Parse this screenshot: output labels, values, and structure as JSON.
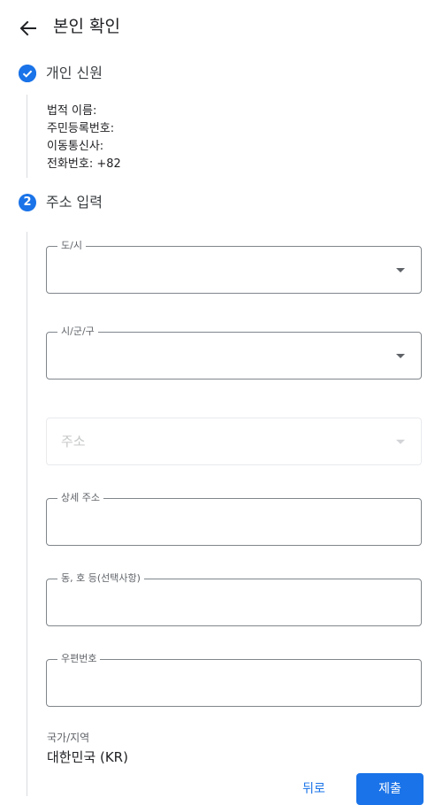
{
  "header": {
    "title": "본인 확인",
    "back_icon": "arrow-left-icon"
  },
  "steps": [
    {
      "number": "",
      "status": "completed",
      "icon": "check-circle-icon",
      "title": "개인 신원",
      "info": [
        "법적 이름:",
        "주민등록번호:",
        "이동통신사:",
        "전화번호: +82"
      ]
    },
    {
      "number": "2",
      "status": "active",
      "title": "주소 입력"
    }
  ],
  "form": {
    "city": {
      "label": "도/시",
      "value": ""
    },
    "district": {
      "label": "시/군/구",
      "value": ""
    },
    "address": {
      "placeholder": "주소",
      "value": ""
    },
    "detail_address": {
      "label": "상세 주소",
      "value": ""
    },
    "building": {
      "label": "동, 호 등(선택사항)",
      "value": ""
    },
    "postal_code": {
      "label": "우편번호",
      "value": ""
    },
    "country_label": "국가/지역",
    "country_value": "대한민국 (KR)"
  },
  "actions": {
    "back_label": "뒤로",
    "submit_label": "제출"
  },
  "colors": {
    "accent": "#1a73e8",
    "border": "#80868b",
    "border_disabled": "#e8eaed",
    "step_line": "#dadce0"
  }
}
